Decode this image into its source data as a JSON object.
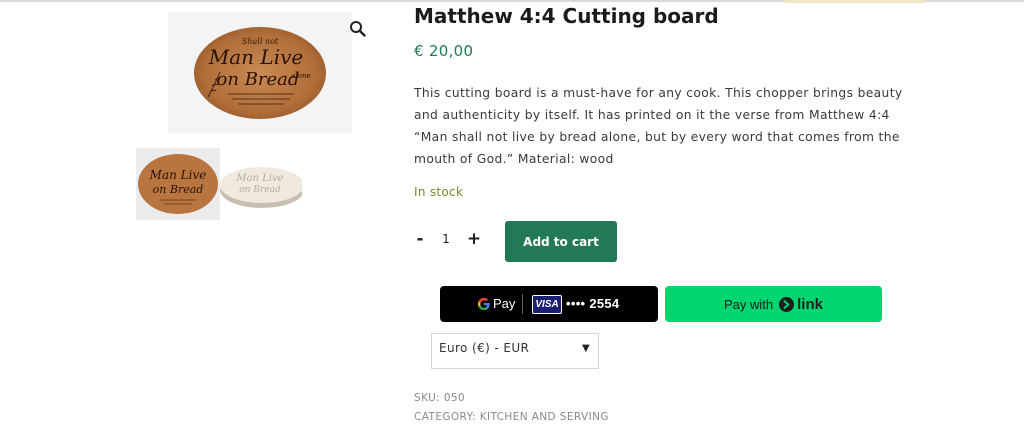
{
  "product": {
    "title": "Matthew 4:4 Cutting board",
    "price": "€ 20,00",
    "description": "This cutting board is a must-have for any cook. This chopper brings beauty and authenticity by itself. It has printed on it the verse from Matthew 4:4 “Man shall not live by bread alone, but by every word that comes from the mouth of God.” Material: wood",
    "stock_status": "In stock",
    "sku_label": "SKU:",
    "sku_value": "050",
    "category_label": "CATEGORY:",
    "category_value": "KITCHEN AND SERVING"
  },
  "gallery": {
    "main_image_engraving": [
      "Shall not",
      "Man Live",
      "on Bread",
      "alone"
    ],
    "thumbnails": [
      "wood-oval-board",
      "white-oval-board"
    ],
    "zoom_icon": "magnifier-icon"
  },
  "cart": {
    "quantity": "1",
    "minus_label": "-",
    "plus_label": "+",
    "add_to_cart_label": "Add to cart"
  },
  "payments": {
    "gpay_label": "Pay",
    "card_brand": "VISA",
    "card_masked": "•••• 2554",
    "link_prefix": "Pay with",
    "link_word": "link"
  },
  "currency": {
    "selected": "Euro (€) - EUR"
  },
  "colors": {
    "price": "#217a52",
    "stock": "#76892a",
    "add_to_cart_bg": "#217a55",
    "link_bg": "#00d66f",
    "gpay_bg": "#000000"
  }
}
